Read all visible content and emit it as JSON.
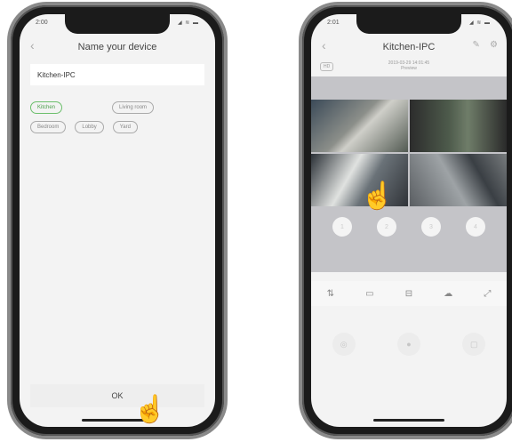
{
  "left_phone": {
    "status": {
      "time": "2:00",
      "icons": "◢ ≋ ▬"
    },
    "nav": {
      "back_icon": "‹",
      "title": "Name your device"
    },
    "device_name": "Kitchen-IPC",
    "room_chips": [
      {
        "label": "Kitchen",
        "selected": true
      },
      {
        "label": "Living room",
        "selected": false
      },
      {
        "label": "Bedroom",
        "selected": false
      },
      {
        "label": "Lobby",
        "selected": false
      },
      {
        "label": "Yard",
        "selected": false
      }
    ],
    "ok_label": "OK"
  },
  "right_phone": {
    "status": {
      "time": "2:01",
      "icons": "◢ ≋ ▬"
    },
    "nav": {
      "back_icon": "‹",
      "title": "Kitchen-IPC",
      "edit_icon": "✎",
      "settings_icon": "⚙"
    },
    "hd_badge": "HD",
    "timestamp": "2019-03-29  14:01:45",
    "status_text": "Preview",
    "channels": [
      "1",
      "2",
      "3",
      "4"
    ],
    "toolbar": [
      "⇅",
      "▭",
      "⊟",
      "☁",
      "⤢"
    ],
    "bottom_controls": [
      "◎",
      "●",
      "▢"
    ]
  },
  "accent": {
    "selected_chip": "#6cbf6c",
    "pointer_hand": "#d8342c"
  }
}
